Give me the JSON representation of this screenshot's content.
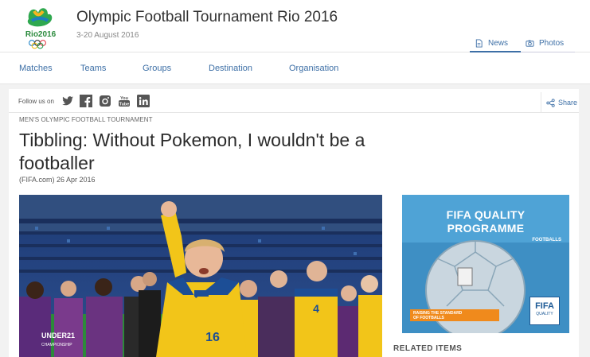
{
  "header": {
    "logo_text": "Rio2016",
    "title": "Olympic Football Tournament Rio 2016",
    "dates": "3-20 August 2016",
    "tabs": [
      {
        "label": "News",
        "icon": "document-icon"
      },
      {
        "label": "Photos",
        "icon": "camera-icon"
      }
    ]
  },
  "nav": {
    "items": [
      "Matches",
      "Teams",
      "Groups",
      "Destination",
      "Organisation"
    ]
  },
  "follow": {
    "label": "Follow us on",
    "networks": [
      "twitter-icon",
      "facebook-icon",
      "instagram-icon",
      "youtube-icon",
      "linkedin-icon"
    ]
  },
  "share": {
    "label": "Share"
  },
  "article": {
    "kicker": "MEN'S OLYMPIC FOOTBALL TOURNAMENT",
    "headline": "Tibbling: Without Pokemon, I wouldn't be a footballer",
    "byline": "(FIFA.com) 26 Apr 2016",
    "photo_text": {
      "shirt_number_main": "16",
      "shirt_number_side": "4",
      "banner": "UNDER21",
      "banner_sub": "CHAMPIONSHIP"
    }
  },
  "ad": {
    "title_line1": "FIFA QUALITY",
    "title_line2": "PROGRAMME",
    "subtitle": "FOOTBALLS",
    "strip_line1": "RAISING THE STANDARD",
    "strip_line2": "OF FOOTBALLS",
    "badge_top": "FIFA",
    "badge_bottom": "QUALITY"
  },
  "related": {
    "label": "RELATED ITEMS"
  },
  "colors": {
    "accent": "#3d6fa6",
    "sweden_yellow": "#f2c519",
    "sweden_blue": "#1c4e96",
    "ad_blue": "#4fa3d6",
    "ad_orange": "#f08a1c"
  }
}
